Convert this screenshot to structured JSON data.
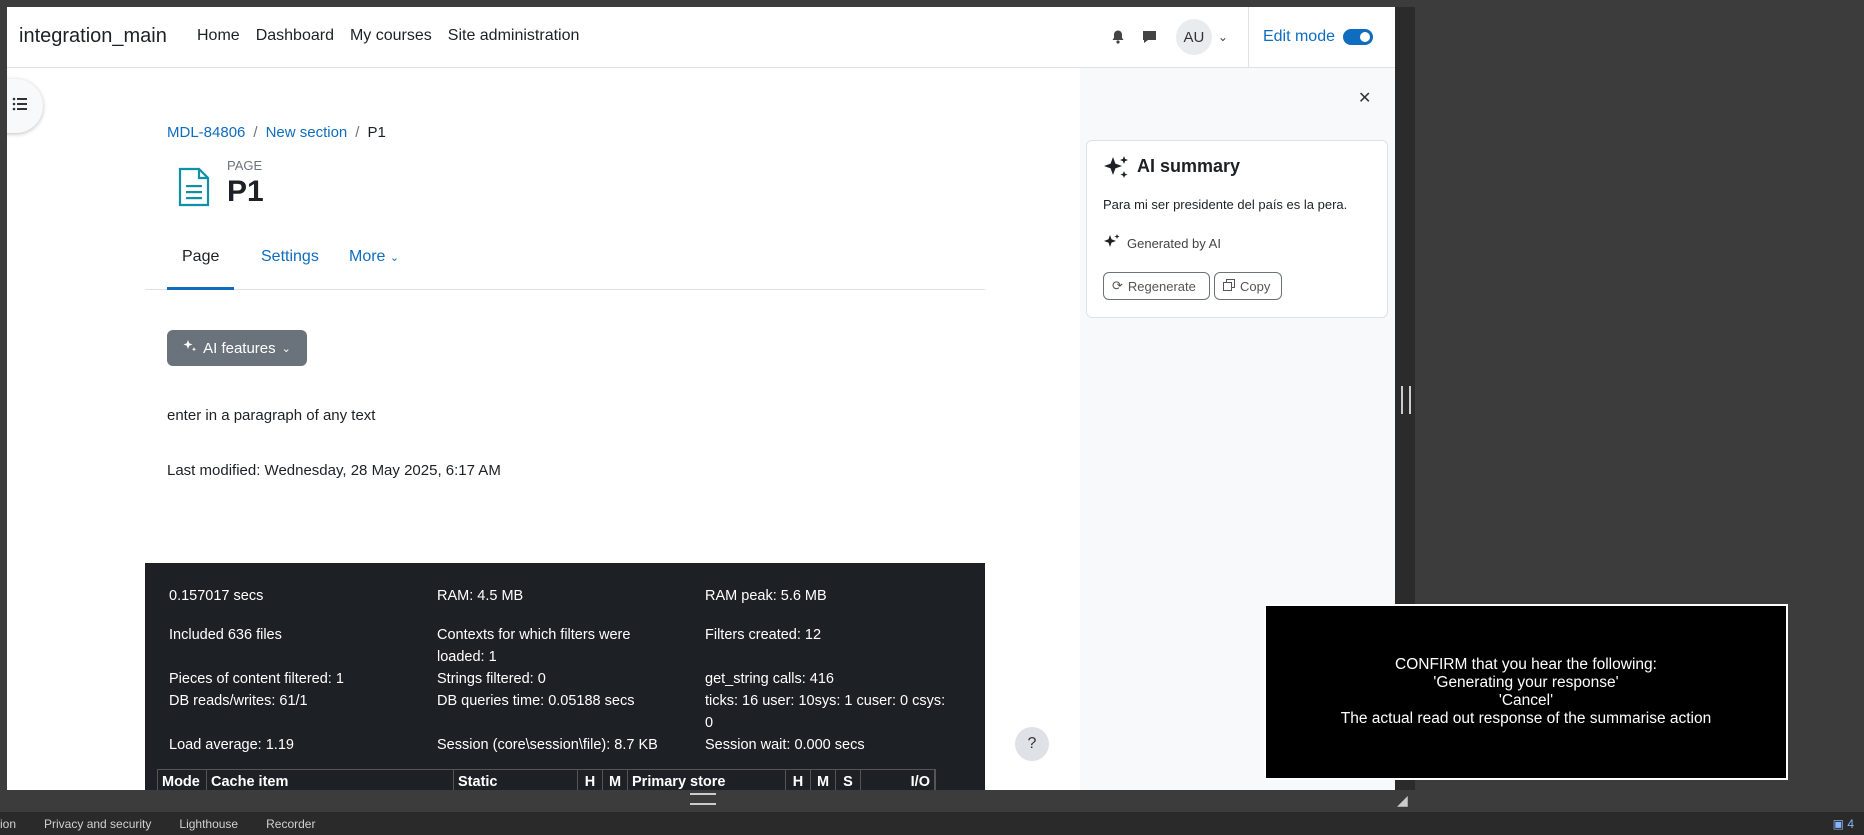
{
  "navbar": {
    "brand": "integration_main",
    "links": [
      "Home",
      "Dashboard",
      "My courses",
      "Site administration"
    ],
    "avatar_initials": "AU",
    "edit_mode_label": "Edit mode"
  },
  "breadcrumb": [
    "MDL-84806",
    "New section",
    "P1"
  ],
  "page_header": {
    "type": "PAGE",
    "title": "P1"
  },
  "tabs": [
    "Page",
    "Settings",
    "More"
  ],
  "ai_features_button": "AI features",
  "content": {
    "paragraph": "enter in a paragraph of any text",
    "last_modified": "Last modified: Wednesday, 28 May 2025, 6:17 AM"
  },
  "performance": {
    "cells": [
      "0.157017 secs",
      "RAM: 4.5 MB",
      "RAM peak: 5.6 MB",
      "Included 636 files",
      "Contexts for which filters were loaded: 1",
      "Filters created: 12",
      "Pieces of content filtered: 1",
      "Strings filtered: 0",
      "get_string calls: 416",
      "DB reads/writes: 61/1",
      "DB queries time: 0.05188 secs",
      "ticks: 16 user: 10sys: 1 cuser: 0 csys: 0",
      "Load average: 1.19",
      "Session (core\\session\\file): 8.7 KB",
      "Session wait: 0.000 secs"
    ],
    "table_headers": [
      "Mode",
      "Cache item",
      "Static",
      "H",
      "M",
      "Primary store",
      "H",
      "M",
      "S",
      "I/O"
    ]
  },
  "ai_summary": {
    "title": "AI summary",
    "text": "Para mi ser presidente del país es la pera.",
    "generated_by": "Generated by AI",
    "regenerate_label": "Regenerate",
    "copy_label": "Copy"
  },
  "help_label": "?",
  "statusbar": {
    "items": [
      "ion",
      "Privacy and security",
      "Lighthouse",
      "Recorder"
    ],
    "badge": "4"
  },
  "overlay": {
    "lines": [
      "CONFIRM that you hear the following:",
      "'Generating your response'",
      "'Cancel'",
      "The actual read out response of the summarise action"
    ]
  }
}
